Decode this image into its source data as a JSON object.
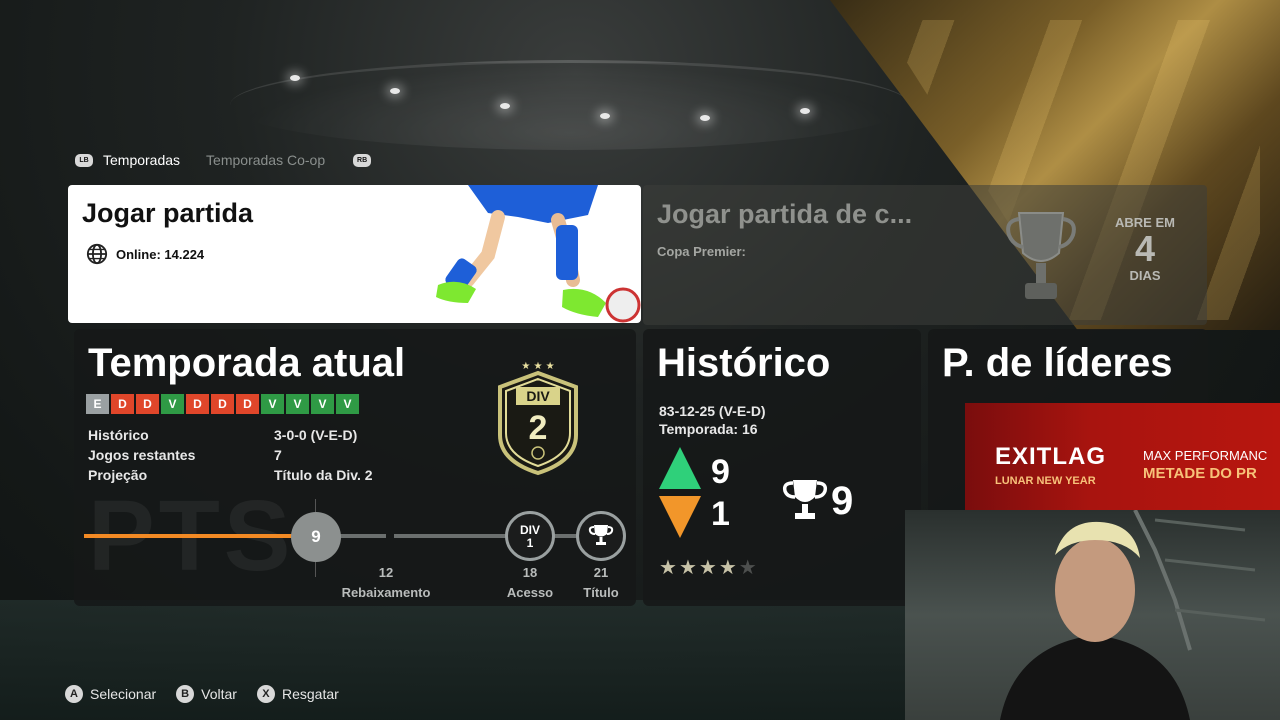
{
  "tabs": {
    "left_bumper": "LB",
    "right_bumper": "RB",
    "items": [
      "Temporadas",
      "Temporadas Co-op"
    ]
  },
  "play_card": {
    "title": "Jogar partida",
    "online": "Online: 14.224"
  },
  "cup_card": {
    "title": "Jogar partida de c...",
    "subtitle": "Copa Premier:",
    "opens_label": "ABRE EM",
    "opens_value": "4",
    "opens_unit": "DIAS"
  },
  "current_season": {
    "title": "Temporada atual",
    "results": [
      "E",
      "D",
      "D",
      "V",
      "D",
      "D",
      "D",
      "V",
      "V",
      "V",
      "V"
    ],
    "stats": [
      {
        "label": "Histórico",
        "value": "3-0-0 (V-E-D)"
      },
      {
        "label": "Jogos restantes",
        "value": "7"
      },
      {
        "label": "Projeção",
        "value": "Título da Div. 2"
      }
    ],
    "division_badge": {
      "label": "DIV",
      "number": "2"
    },
    "pts_watermark": "PTS",
    "points": "9",
    "milestone_div_line1": "DIV",
    "milestone_div_line2": "1",
    "thresholds": [
      {
        "value": "12",
        "label": "Rebaixamento"
      },
      {
        "value": "18",
        "label": "Acesso"
      },
      {
        "value": "21",
        "label": "Título"
      }
    ]
  },
  "history": {
    "title": "Histórico",
    "record": "83-12-25 (V-E-D)",
    "season": "Temporada: 16",
    "promotions": "9",
    "relegations": "1",
    "titles": "9",
    "stars_filled": 4,
    "stars_total": 5
  },
  "leaders": {
    "title": "P. de líderes"
  },
  "ad": {
    "logo": "EXITLAG",
    "sub": "LUNAR NEW YEAR",
    "line1": "MAX PERFORMANC",
    "line2": "METADE DO PR"
  },
  "footer": [
    {
      "button": "A",
      "label": "Selecionar"
    },
    {
      "button": "B",
      "label": "Voltar"
    },
    {
      "button": "X",
      "label": "Resgatar"
    }
  ],
  "colors": {
    "loss": "#e0462a",
    "win": "#2f9a45",
    "draw": "#9aa0a2",
    "progress": "#f38a24",
    "promotion": "#2fd07a",
    "relegation": "#f2962a"
  }
}
